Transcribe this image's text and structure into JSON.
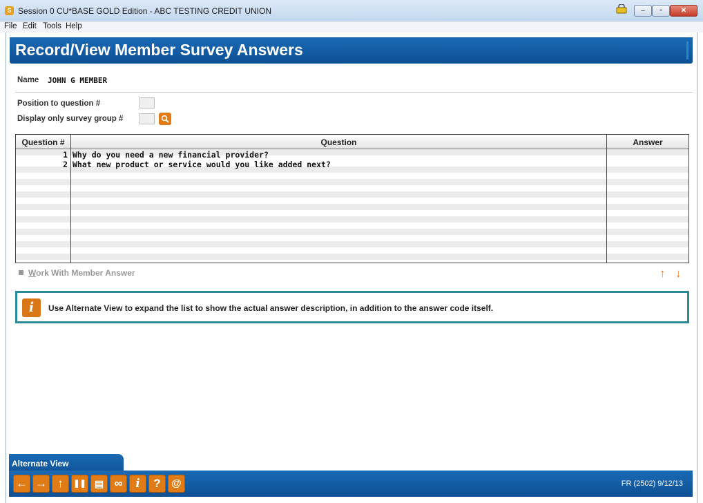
{
  "window": {
    "title": "Session 0 CU*BASE GOLD Edition - ABC TESTING CREDIT UNION",
    "app_icon_glyph": "S"
  },
  "menu": {
    "items": [
      "File",
      "Edit",
      "Tools",
      "Help"
    ]
  },
  "page": {
    "title": "Record/View Member Survey Answers"
  },
  "member": {
    "name_label": "Name",
    "name_value": "JOHN G MEMBER"
  },
  "filters": {
    "position_label": "Position to question #",
    "position_value": "",
    "group_label": "Display only survey group #",
    "group_value": ""
  },
  "grid": {
    "headers": [
      "Question #",
      "Question",
      "Answer"
    ],
    "rows": [
      {
        "num": "1",
        "question": "Why do you need a new financial provider?",
        "answer": ""
      },
      {
        "num": "2",
        "question": "What new product or service would you like added next?",
        "answer": ""
      }
    ]
  },
  "actions": {
    "work_with_answer_prefix": "W",
    "work_with_answer_rest": "ork With Member Answer"
  },
  "info": {
    "icon_glyph": "i",
    "text": "Use Alternate View to expand the list to show the actual answer description, in addition to the answer code itself."
  },
  "tabs": {
    "alternate_view": "Alternate View"
  },
  "toolbar": {
    "buttons": [
      {
        "icon": "back-arrow-icon",
        "glyph": "←"
      },
      {
        "icon": "forward-arrow-icon",
        "glyph": "→"
      },
      {
        "icon": "up-arrow-icon",
        "glyph": "↑"
      },
      {
        "icon": "pause-icon",
        "glyph": "❚❚"
      },
      {
        "icon": "print-icon",
        "glyph": "▤"
      },
      {
        "icon": "link-icon",
        "glyph": "∞"
      },
      {
        "icon": "info-icon",
        "glyph": "i"
      },
      {
        "icon": "help-icon",
        "glyph": "?"
      },
      {
        "icon": "at-icon",
        "glyph": "@"
      }
    ],
    "status": "FR (2502) 9/12/13"
  },
  "colors": {
    "header_blue": "#0d4f93",
    "accent_orange": "#e07b15",
    "info_border_teal": "#2a8a96"
  }
}
